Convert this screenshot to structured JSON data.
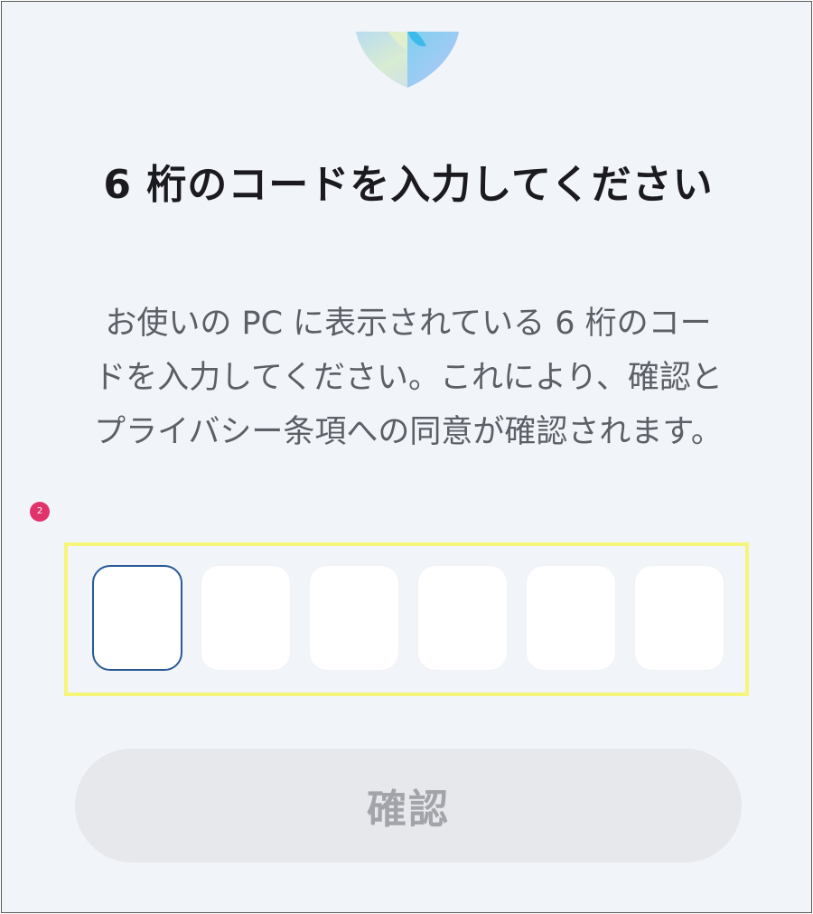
{
  "heading": "6 桁のコードを入力してください",
  "description": "お使いの PC に表示されている 6 桁のコードを入力してください。これにより、確認とプライバシー条項への同意が確認されます。",
  "badge": "2",
  "code_inputs": [
    "",
    "",
    "",
    "",
    "",
    ""
  ],
  "confirm_label": "確認",
  "colors": {
    "background": "#f1f4f9",
    "active_border": "#2a5a96",
    "highlight": "#f5f57a",
    "badge": "#e0336c",
    "button_bg": "#e7e8ec",
    "button_text": "#a3a4aa"
  },
  "icons": {
    "logo": "shield-logo"
  }
}
